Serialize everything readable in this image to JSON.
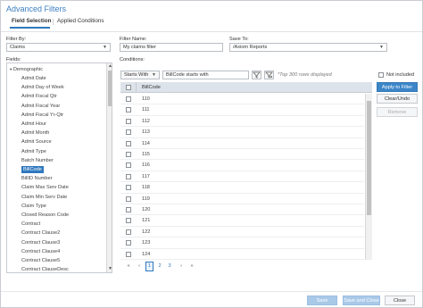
{
  "window": {
    "title": "Advanced Filters"
  },
  "tabs": [
    {
      "label": "Field Selection"
    },
    {
      "label": "Applied Conditions"
    }
  ],
  "filter_by": {
    "label": "Filter By:",
    "value": "Claims"
  },
  "filter_name": {
    "label": "Filter Name:",
    "value": "My claims filter"
  },
  "save_to": {
    "label": "Save To:",
    "value": "/Axiom Reports"
  },
  "fields": {
    "label": "Fields:",
    "group": "Demographic",
    "items": [
      "Admit Date",
      "Admit Day of Week",
      "Admit Fiscal Qtr",
      "Admit Fiscal Year",
      "Admit Fiscal Yr-Qtr",
      "Admit Hour",
      "Admit Month",
      "Admit Source",
      "Admit Type",
      "Batch Number",
      "BillCode",
      "BillID Number",
      "Claim Max Serv Date",
      "Claim Min Serv Date",
      "Claim Type",
      "Closed Reason Code",
      "Contract",
      "Contract Clause2",
      "Contract Clause3",
      "Contract Clause4",
      "Contract Clause5",
      "Contract ClauseDesc"
    ],
    "selected": "BillCode"
  },
  "conditions": {
    "label": "Conditions:",
    "operator": "Starts With",
    "expression": "BillCode starts with",
    "note": "*Top 300 rows displayed",
    "not_included_label": "Not included",
    "column_header": "BillCode",
    "rows": [
      "110",
      "111",
      "112",
      "113",
      "114",
      "115",
      "116",
      "117",
      "118",
      "119",
      "120",
      "121",
      "122",
      "123",
      "124"
    ]
  },
  "pager": {
    "first": "«",
    "prev": "‹",
    "pages": [
      "1",
      "2",
      "3"
    ],
    "current": "1",
    "next": "›",
    "last": "»"
  },
  "side_buttons": {
    "apply": "Apply to Filter",
    "clear": "Clear/Undo",
    "remove": "Remove"
  },
  "footer": {
    "save": "Save",
    "save_close": "Save and Close",
    "close": "Close"
  },
  "colors": {
    "accent": "#2f78be",
    "header": "#dde3ea"
  }
}
